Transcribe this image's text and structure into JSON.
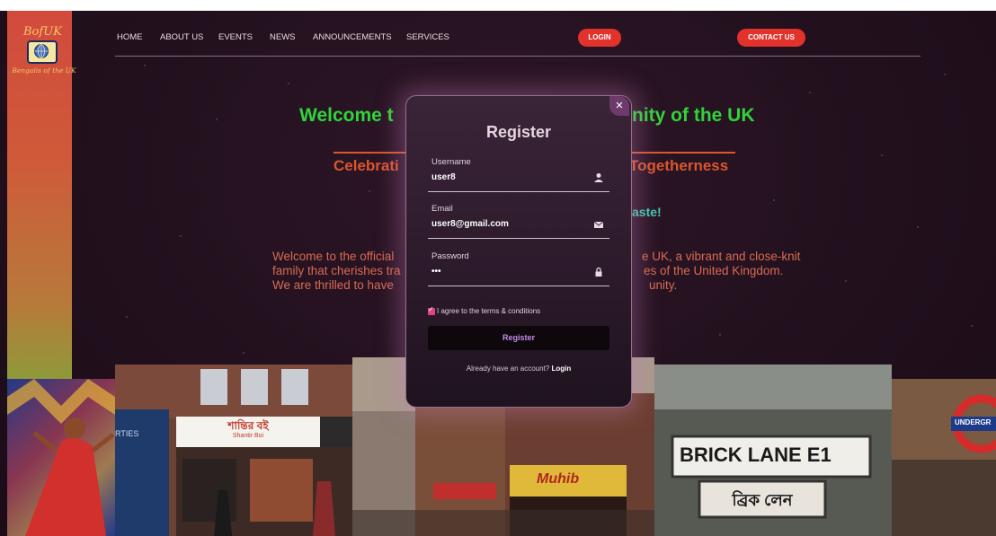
{
  "logo": {
    "title": "BofUK",
    "subtitle": "Bengalis of the UK"
  },
  "nav": {
    "items": [
      "HOME",
      "ABOUT US",
      "EVENTS",
      "NEWS",
      "ANNOUNCEMENTS",
      "SERVICES"
    ],
    "login": "LOGIN",
    "contact": "CONTACT US"
  },
  "hero": {
    "welcome_left": "Welcome t",
    "welcome_right": "nity of the UK",
    "celebrate_left": "Celebrati",
    "celebrate_right": "Togetherness",
    "taste": "aste!",
    "para_left": [
      "Welcome to the official",
      "family that cherishes tra",
      "We are thrilled to have"
    ],
    "para_right": [
      "e UK, a vibrant and close-knit",
      "es of the United Kingdom.",
      "unity."
    ]
  },
  "gallery": {
    "shop_sign_bn": "শান্তির বই",
    "shop_sign_en": "Shantir Boi",
    "street_sign": "BRICK LANE E1",
    "street_sign_bn": "ব্রিক লেন",
    "store": "Muhib",
    "tube": "UNDERGR",
    "shop_text": "RTIES"
  },
  "modal": {
    "title": "Register",
    "username_label": "Username",
    "username_value": "user8",
    "email_label": "Email",
    "email_value": "user8@gmail.com",
    "password_label": "Password",
    "password_value": "•••",
    "agree": "I agree to the terms & conditions",
    "submit": "Register",
    "have_account": "Already have an account?",
    "login_link": "Login",
    "close": "×"
  },
  "colors": {
    "accent_red": "#e2322c",
    "welcome_green": "#2fd43a",
    "orange": "#d9562e",
    "teal": "#3ec9b4"
  }
}
